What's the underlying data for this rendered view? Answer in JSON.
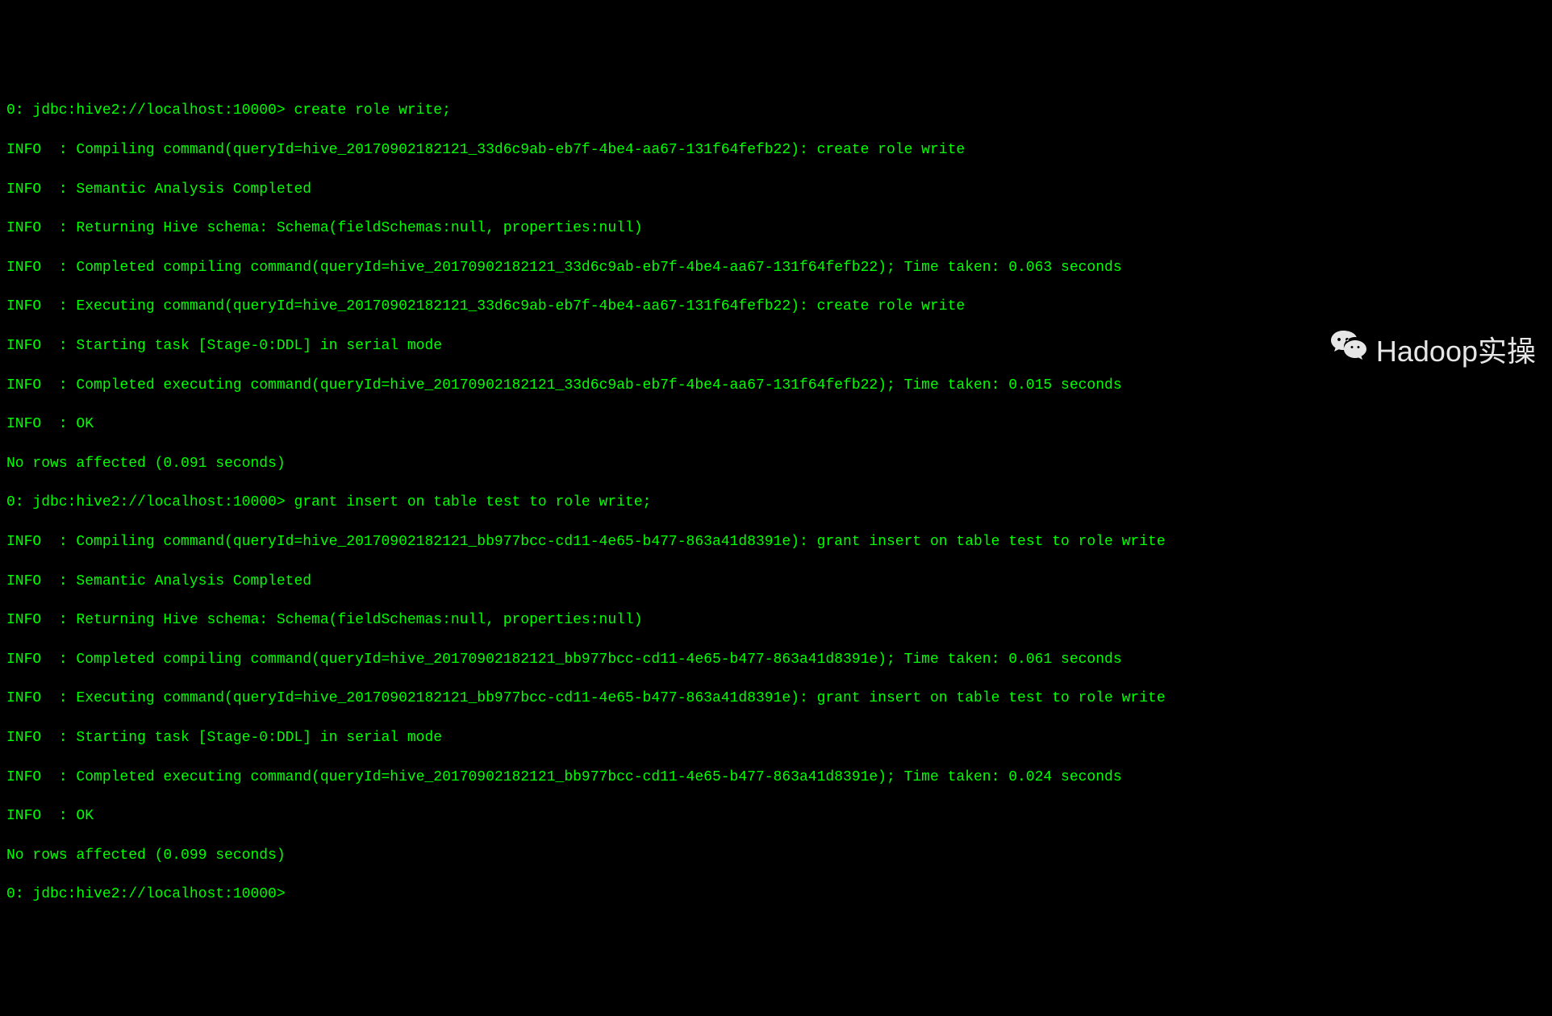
{
  "terminal": {
    "lines": [
      "0: jdbc:hive2://localhost:10000> create role write;",
      "INFO  : Compiling command(queryId=hive_20170902182121_33d6c9ab-eb7f-4be4-aa67-131f64fefb22): create role write",
      "INFO  : Semantic Analysis Completed",
      "INFO  : Returning Hive schema: Schema(fieldSchemas:null, properties:null)",
      "INFO  : Completed compiling command(queryId=hive_20170902182121_33d6c9ab-eb7f-4be4-aa67-131f64fefb22); Time taken: 0.063 seconds",
      "INFO  : Executing command(queryId=hive_20170902182121_33d6c9ab-eb7f-4be4-aa67-131f64fefb22): create role write",
      "INFO  : Starting task [Stage-0:DDL] in serial mode",
      "INFO  : Completed executing command(queryId=hive_20170902182121_33d6c9ab-eb7f-4be4-aa67-131f64fefb22); Time taken: 0.015 seconds",
      "INFO  : OK",
      "No rows affected (0.091 seconds)",
      "0: jdbc:hive2://localhost:10000> grant insert on table test to role write;",
      "INFO  : Compiling command(queryId=hive_20170902182121_bb977bcc-cd11-4e65-b477-863a41d8391e): grant insert on table test to role write",
      "INFO  : Semantic Analysis Completed",
      "INFO  : Returning Hive schema: Schema(fieldSchemas:null, properties:null)",
      "INFO  : Completed compiling command(queryId=hive_20170902182121_bb977bcc-cd11-4e65-b477-863a41d8391e); Time taken: 0.061 seconds",
      "INFO  : Executing command(queryId=hive_20170902182121_bb977bcc-cd11-4e65-b477-863a41d8391e): grant insert on table test to role write",
      "INFO  : Starting task [Stage-0:DDL] in serial mode",
      "INFO  : Completed executing command(queryId=hive_20170902182121_bb977bcc-cd11-4e65-b477-863a41d8391e); Time taken: 0.024 seconds",
      "INFO  : OK",
      "No rows affected (0.099 seconds)",
      "0: jdbc:hive2://localhost:10000> "
    ]
  },
  "watermark": {
    "text": "Hadoop实操"
  }
}
